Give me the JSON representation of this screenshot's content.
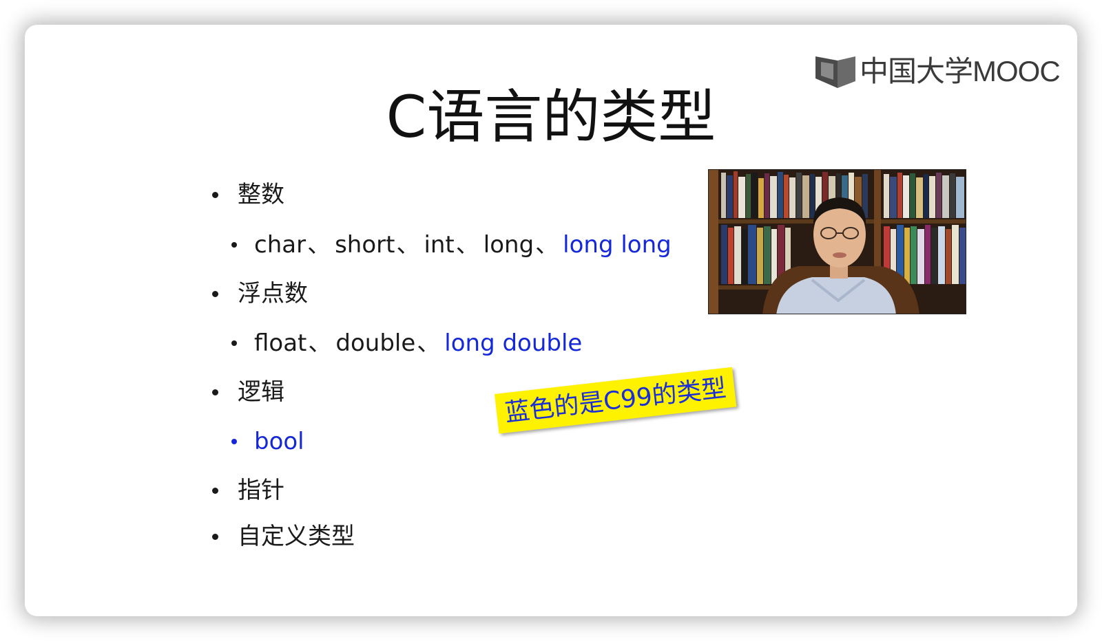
{
  "logo": {
    "text": "中国大学MOOC"
  },
  "title": "C语言的类型",
  "outline": [
    {
      "text": "整数"
    },
    {
      "parts": [
        {
          "text": "char",
          "c99": false
        },
        {
          "text": "short",
          "c99": false
        },
        {
          "text": "int",
          "c99": false
        },
        {
          "text": "long",
          "c99": false
        },
        {
          "text": "long long",
          "c99": true
        }
      ]
    },
    {
      "text": "浮点数"
    },
    {
      "parts": [
        {
          "text": "float",
          "c99": false
        },
        {
          "text": "double",
          "c99": false
        },
        {
          "text": "long double",
          "c99": true
        }
      ]
    },
    {
      "text": "逻辑"
    },
    {
      "parts": [
        {
          "text": "bool",
          "c99": true
        }
      ]
    },
    {
      "text": "指针"
    },
    {
      "text": "自定义类型"
    }
  ],
  "separator": "、",
  "note": "蓝色的是C99的类型",
  "colors": {
    "c99_blue": "#1428d8",
    "note_bg": "#fff200",
    "text": "#1a1a1a"
  }
}
